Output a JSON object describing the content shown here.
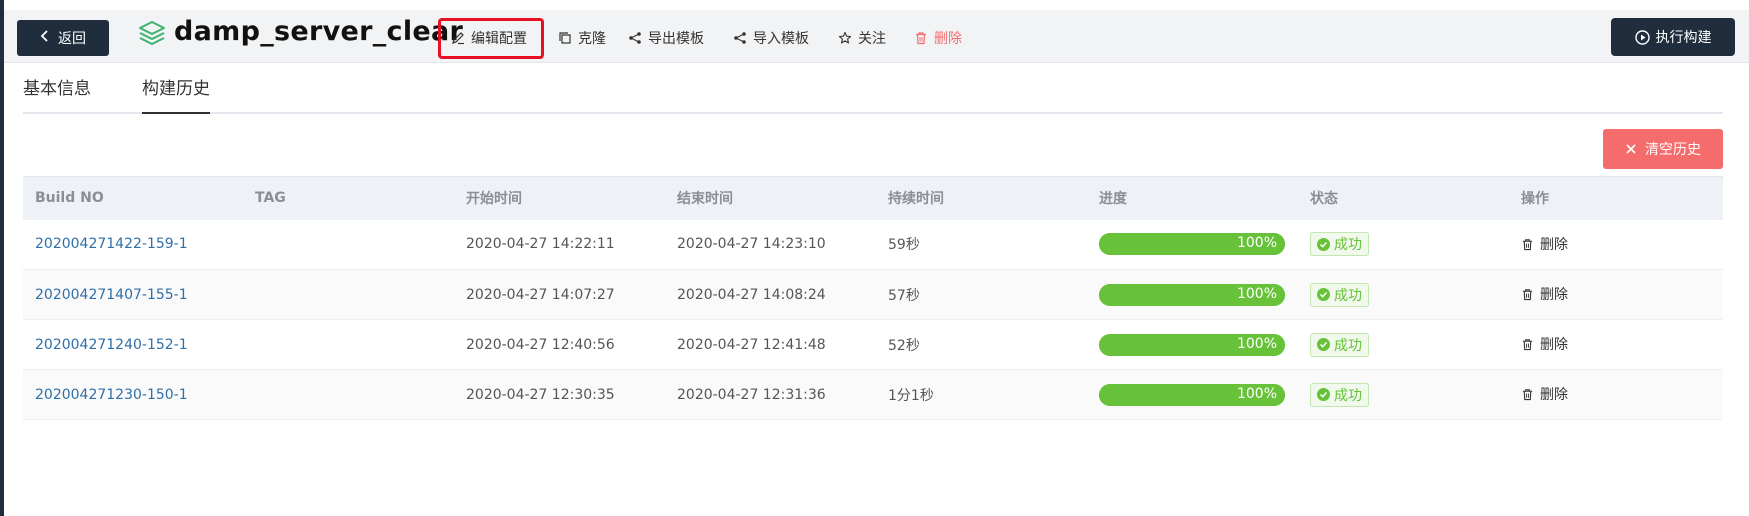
{
  "header": {
    "back_label": "返回",
    "title": "damp_server_clear",
    "actions": {
      "edit": "编辑配置",
      "clone": "克隆",
      "export": "导出模板",
      "import": "导入模板",
      "follow": "关注",
      "delete": "删除"
    },
    "run_label": "执行构建"
  },
  "tabs": [
    {
      "label": "基本信息"
    },
    {
      "label": "构建历史"
    }
  ],
  "clear_history_label": "清空历史",
  "table": {
    "columns": [
      "Build NO",
      "TAG",
      "开始时间",
      "结束时间",
      "持续时间",
      "进度",
      "状态",
      "操作"
    ],
    "rows": [
      {
        "build_no": "202004271422-159-1",
        "tag": "",
        "start": "2020-04-27 14:22:11",
        "end": "2020-04-27 14:23:10",
        "duration": "59秒",
        "progress": "100%",
        "status": "成功",
        "op": "删除"
      },
      {
        "build_no": "202004271407-155-1",
        "tag": "",
        "start": "2020-04-27 14:07:27",
        "end": "2020-04-27 14:08:24",
        "duration": "57秒",
        "progress": "100%",
        "status": "成功",
        "op": "删除"
      },
      {
        "build_no": "202004271240-152-1",
        "tag": "",
        "start": "2020-04-27 12:40:56",
        "end": "2020-04-27 12:41:48",
        "duration": "52秒",
        "progress": "100%",
        "status": "成功",
        "op": "删除"
      },
      {
        "build_no": "202004271230-150-1",
        "tag": "",
        "start": "2020-04-27 12:30:35",
        "end": "2020-04-27 12:31:36",
        "duration": "1分1秒",
        "progress": "100%",
        "status": "成功",
        "op": "删除"
      }
    ]
  },
  "colors": {
    "dark": "#1f2d3d",
    "success": "#67c23a",
    "danger": "#f56c6c",
    "link": "#2f6fa8",
    "highlight": "#e81123"
  },
  "icons": [
    "chevron-left-icon",
    "layers-icon",
    "edit-icon",
    "copy-icon",
    "share-icon",
    "star-icon",
    "trash-icon",
    "play-circle-icon",
    "close-icon",
    "check-circle-icon"
  ]
}
